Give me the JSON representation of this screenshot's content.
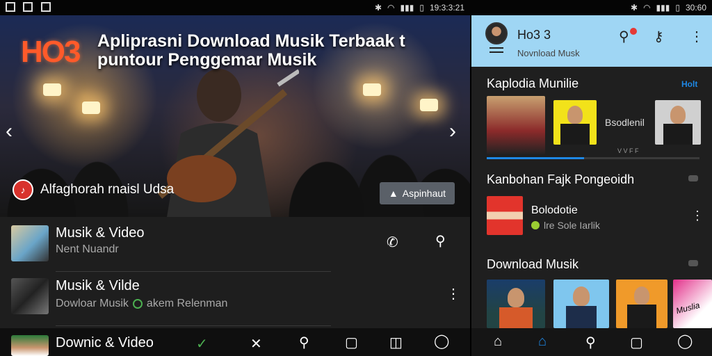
{
  "status_left": {
    "time": "19:3:3:21"
  },
  "status_right": {
    "time": "30:60"
  },
  "hero": {
    "logo": "HO3",
    "title": "Apliprasni Download Musik Terbaak t puntour Penggemar Musik",
    "footer_text": "Alfaghorah rnaisl Udsa",
    "button_label": "Aspinhaut"
  },
  "left_list": {
    "items": [
      {
        "title": "Musik & Video",
        "subtitle": "Nent Nuandr"
      },
      {
        "title": "Musik & Vilde",
        "subtitle": "Dowloar Musik",
        "extra": "akem Relenman"
      },
      {
        "title": "Downic & Video"
      }
    ]
  },
  "right_panel": {
    "app_title": "Ho3 3",
    "app_subtitle": "Novnload Musk",
    "section1": {
      "title": "Kaplodia Munilie",
      "link": "Holt",
      "card_label": "Bsodlenil",
      "tag": "V V F F"
    },
    "section2": {
      "title": "Kanbohan Fajk Pongeoidh",
      "item_title": "Bolodotie",
      "item_sub": "lre Sole Iarlik"
    },
    "section3": {
      "title": "Download Musik",
      "card4_text": "Muslia"
    }
  },
  "colors": {
    "accent": "#1e88e5",
    "header_bg": "#9fd6f4",
    "logo": "#ff5a2a",
    "alert": "#e53935"
  },
  "icons": [
    "phone-icon",
    "search-icon",
    "more-vert-icon",
    "check-icon",
    "close-icon",
    "square-icon",
    "gallery-icon",
    "profile-icon",
    "home-icon",
    "key-icon",
    "bluetooth-icon",
    "wifi-icon",
    "signal-icon",
    "battery-icon"
  ]
}
